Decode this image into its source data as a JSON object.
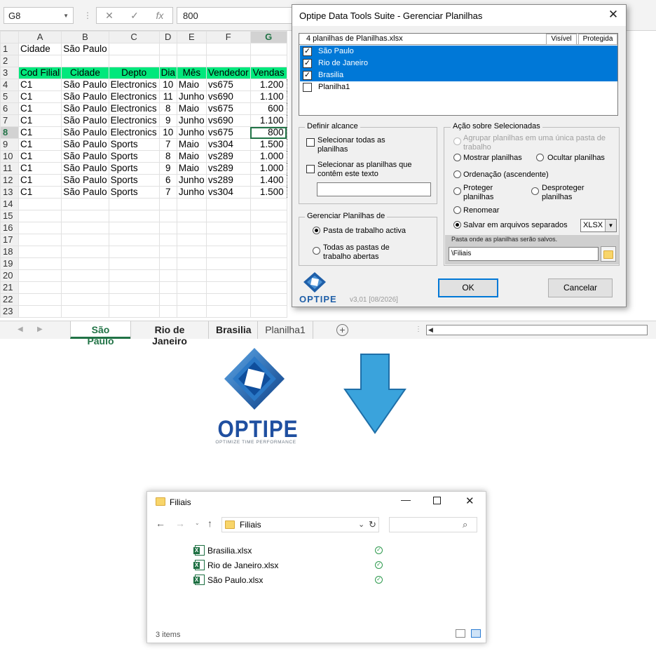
{
  "formula_bar": {
    "cell_ref": "G8",
    "value": "800",
    "fx": "fx"
  },
  "grid": {
    "columns": [
      "A",
      "B",
      "C",
      "D",
      "E",
      "F",
      "G"
    ],
    "rows": [
      {
        "n": "1",
        "cells": [
          "Cidade",
          "São Paulo",
          "",
          "",
          "",
          "",
          ""
        ]
      },
      {
        "n": "2",
        "cells": [
          "",
          "",
          "",
          "",
          "",
          "",
          ""
        ]
      },
      {
        "n": "3",
        "cells": [
          "Cod Filial",
          "Cidade",
          "Depto",
          "Dia",
          "Mês",
          "Vendedor",
          "Vendas"
        ]
      },
      {
        "n": "4",
        "cells": [
          "C1",
          "São Paulo",
          "Electronics",
          "10",
          "Maio",
          "vs675",
          "1.200"
        ]
      },
      {
        "n": "5",
        "cells": [
          "C1",
          "São Paulo",
          "Electronics",
          "11",
          "Junho",
          "vs690",
          "1.100"
        ]
      },
      {
        "n": "6",
        "cells": [
          "C1",
          "São Paulo",
          "Electronics",
          "8",
          "Maio",
          "vs675",
          "600"
        ]
      },
      {
        "n": "7",
        "cells": [
          "C1",
          "São Paulo",
          "Electronics",
          "9",
          "Junho",
          "vs690",
          "1.100"
        ]
      },
      {
        "n": "8",
        "cells": [
          "C1",
          "São Paulo",
          "Electronics",
          "10",
          "Junho",
          "vs675",
          "800"
        ]
      },
      {
        "n": "9",
        "cells": [
          "C1",
          "São Paulo",
          "Sports",
          "7",
          "Maio",
          "vs304",
          "1.500"
        ]
      },
      {
        "n": "10",
        "cells": [
          "C1",
          "São Paulo",
          "Sports",
          "8",
          "Maio",
          "vs289",
          "1.000"
        ]
      },
      {
        "n": "11",
        "cells": [
          "C1",
          "São Paulo",
          "Sports",
          "9",
          "Maio",
          "vs289",
          "1.000"
        ]
      },
      {
        "n": "12",
        "cells": [
          "C1",
          "São Paulo",
          "Sports",
          "6",
          "Junho",
          "vs289",
          "1.400"
        ]
      },
      {
        "n": "13",
        "cells": [
          "C1",
          "São Paulo",
          "Sports",
          "7",
          "Junho",
          "vs304",
          "1.500"
        ]
      },
      {
        "n": "14",
        "cells": [
          "",
          "",
          "",
          "",
          "",
          "",
          ""
        ]
      },
      {
        "n": "15",
        "cells": [
          "",
          "",
          "",
          "",
          "",
          "",
          ""
        ]
      },
      {
        "n": "16",
        "cells": [
          "",
          "",
          "",
          "",
          "",
          "",
          ""
        ]
      },
      {
        "n": "17",
        "cells": [
          "",
          "",
          "",
          "",
          "",
          "",
          ""
        ]
      },
      {
        "n": "18",
        "cells": [
          "",
          "",
          "",
          "",
          "",
          "",
          ""
        ]
      },
      {
        "n": "19",
        "cells": [
          "",
          "",
          "",
          "",
          "",
          "",
          ""
        ]
      },
      {
        "n": "20",
        "cells": [
          "",
          "",
          "",
          "",
          "",
          "",
          ""
        ]
      },
      {
        "n": "21",
        "cells": [
          "",
          "",
          "",
          "",
          "",
          "",
          ""
        ]
      },
      {
        "n": "22",
        "cells": [
          "",
          "",
          "",
          "",
          "",
          "",
          ""
        ]
      },
      {
        "n": "23",
        "cells": [
          "",
          "",
          "",
          "",
          "",
          "",
          ""
        ]
      }
    ]
  },
  "sheet_tabs": [
    "São Paulo",
    "Rio de Janeiro",
    "Brasilia",
    "Planilha1"
  ],
  "dialog": {
    "title": "Optipe Data Tools Suite - Gerenciar Planilhas",
    "list_header": "4 planilhas de Planilhas.xlsx",
    "col_visible": "Visível",
    "col_protected": "Protegida",
    "sheets": [
      {
        "name": "São Paulo",
        "checked": true
      },
      {
        "name": "Rio de Janeiro",
        "checked": true
      },
      {
        "name": "Brasilia",
        "checked": true
      },
      {
        "name": "Planilha1",
        "checked": false
      }
    ],
    "scope": {
      "title": "Definir alcance",
      "select_all_1": "Selecionar todas as",
      "select_all_2": "planilhas",
      "select_text_1": "Selecionar as planilhas que",
      "select_text_2": "contêm este texto",
      "text_value": ""
    },
    "manage": {
      "title": "Gerenciar Planilhas de",
      "active": "Pasta de trabalho activa",
      "all_1": "Todas as pastas de",
      "all_2": "trabalho abertas"
    },
    "action": {
      "title": "Ação sobre Selecionadas",
      "group_1": "Agrupar planilhas em uma única pasta de",
      "group_2": "trabalho",
      "show": "Mostrar planilhas",
      "hide": "Ocultar planilhas",
      "sort": "Ordenação (ascendente)",
      "protect_1": "Proteger",
      "protect_2": "planilhas",
      "unprotect_1": "Desproteger",
      "unprotect_2": "planilhas",
      "rename": "Renomear",
      "save_separate": "Salvar em arquivos separados",
      "format": "XLSX",
      "folder_caption": "Pasta onde as planilhas serão salvos.",
      "folder_value": "\\Filiais"
    },
    "ok": "OK",
    "cancel": "Cancelar",
    "brand": "OPTIPE",
    "version": "v3,01 [08/2026]"
  },
  "logo": {
    "name": "OPTIPE",
    "tagline": "OPTIMIZE TIME PERFORMANCE"
  },
  "arrow_color": "#3aa3dc",
  "explorer": {
    "title": "Filiais",
    "address": "Filiais",
    "files": [
      "Brasilia.xlsx",
      "Rio de Janeiro.xlsx",
      "São Paulo.xlsx"
    ],
    "status": "3 items"
  }
}
